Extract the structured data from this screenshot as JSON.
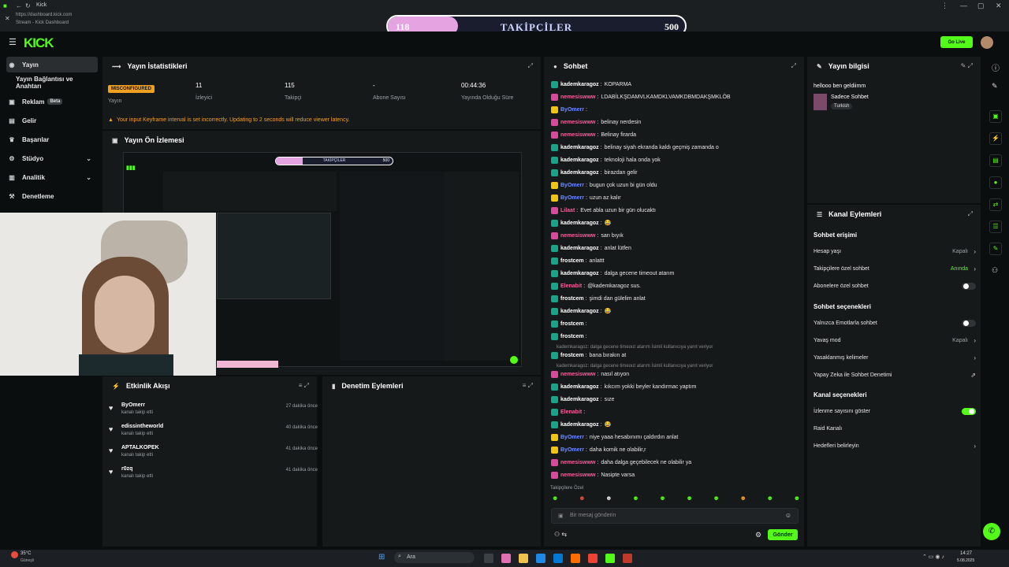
{
  "browser": {
    "tab_title": "Kick",
    "url": "https://dashboard.kick.com",
    "subtitle": "Stream - Kick Dashboard"
  },
  "goal": {
    "label": "TAKİPÇİLER",
    "current": "118",
    "target": "500",
    "progress": 0.236
  },
  "nav": {
    "logo": "KICK",
    "go_live": "Go Live"
  },
  "sidebar": {
    "items": [
      {
        "label": "Yayın",
        "icon": "broadcast-icon"
      },
      {
        "label": "Yayın Bağlantısı ve Anahtarı",
        "icon": "key-icon"
      },
      {
        "label": "Reklam",
        "badge": "Beta",
        "icon": "ad-icon"
      },
      {
        "label": "Gelir",
        "icon": "money-icon"
      },
      {
        "label": "Başarılar",
        "icon": "trophy-icon"
      },
      {
        "label": "Stüdyo",
        "icon": "studio-icon"
      },
      {
        "label": "Analitik",
        "icon": "chart-icon"
      },
      {
        "label": "Denetleme",
        "icon": "hammer-icon"
      }
    ]
  },
  "stats": {
    "title": "Yayın İstatistikleri",
    "status_badge": "MISCONFIGURED",
    "status_label": "Yayın",
    "viewers_value": "11",
    "viewers_label": "İzleyici",
    "followers_value": "115",
    "followers_label": "Takipçi",
    "subs_value": "-",
    "subs_label": "Abone Sayısı",
    "uptime_value": "00:44:36",
    "uptime_label": "Yayında Olduğu Süre",
    "warning": "Your input Keyframe interval is set incorrectly. Updating to 2 seconds will reduce viewer latency."
  },
  "preview": {
    "title": "Yayın Ön İzlemesi",
    "goal_label": "TAKİPÇİLER",
    "goal_target": "500"
  },
  "activity": {
    "title": "Etkinlik Akışı",
    "items": [
      {
        "name": "ByOmerr",
        "sub": "kanalı takip etti",
        "time": "27 dakika önce"
      },
      {
        "name": "edissintheworld",
        "sub": "kanalı takip etti",
        "time": "40 dakika önce"
      },
      {
        "name": "APTALKOPEK",
        "sub": "kanalı takip etti",
        "time": "41 dakika önce"
      },
      {
        "name": "r0zq",
        "sub": "kanalı takip etti",
        "time": "41 dakika önce"
      }
    ]
  },
  "moderation": {
    "title": "Denetim Eylemleri"
  },
  "chat": {
    "title": "Sohbet",
    "messages": [
      {
        "user": "kademkaragoz",
        "color": "#ffffff",
        "badge": "#17a589",
        "text": "KOPARMA"
      },
      {
        "user": "nemesiswww",
        "color": "#f0609a",
        "badge": "#d9489b",
        "text": "LDABİLKŞDAMVLKAMDKLVAMKDBMDAKŞMKLÖB"
      },
      {
        "user": "ByOmerr",
        "color": "#6f8cff",
        "badge": "#f1c40f",
        "text": ""
      },
      {
        "user": "nemesiswww",
        "color": "#f0609a",
        "badge": "#d9489b",
        "text": "belinay nerdesin"
      },
      {
        "user": "nemesiswww",
        "color": "#f0609a",
        "badge": "#d9489b",
        "text": "Belinay firarda"
      },
      {
        "user": "kademkaragoz",
        "color": "#ffffff",
        "badge": "#17a589",
        "text": "belinay siyah ekranda kaldı geçmiş zamanda o"
      },
      {
        "user": "kademkaragoz",
        "color": "#ffffff",
        "badge": "#17a589",
        "text": "teknoloji hala onda yok"
      },
      {
        "user": "kademkaragoz",
        "color": "#ffffff",
        "badge": "#17a589",
        "text": "birazdan gelir"
      },
      {
        "user": "ByOmerr",
        "color": "#6f8cff",
        "badge": "#f1c40f",
        "text": "bugun çok uzun bi gün oldu"
      },
      {
        "user": "ByOmerr",
        "color": "#6f8cff",
        "badge": "#f1c40f",
        "text": "uzun az kalır"
      },
      {
        "user": "Lilaat",
        "color": "#f0609a",
        "badge": "#d9489b",
        "text": "Evet abla uzun bir gün olucaktı"
      },
      {
        "user": "kademkaragoz",
        "color": "#ffffff",
        "badge": "#17a589",
        "text": "😂"
      },
      {
        "user": "nemesiswww",
        "color": "#f0609a",
        "badge": "#d9489b",
        "text": "sarı bıyık"
      },
      {
        "user": "kademkaragoz",
        "color": "#ffffff",
        "badge": "#17a589",
        "text": "anlat lütfen"
      },
      {
        "user": "frostcem",
        "color": "#ffffff",
        "badge": "#17a589",
        "text": "anlattt"
      },
      {
        "user": "kademkaragoz",
        "color": "#ffffff",
        "badge": "#17a589",
        "text": "dalga gecene timeout atarım"
      },
      {
        "user": "Elenabit",
        "color": "#f0609a",
        "badge": "#17a589",
        "text": "@kademkaragoz sus."
      },
      {
        "user": "frostcem",
        "color": "#ffffff",
        "badge": "#17a589",
        "text": "şimdi dan gülelim anlat"
      },
      {
        "user": "kademkaragoz",
        "color": "#ffffff",
        "badge": "#17a589",
        "text": "😂"
      },
      {
        "user": "frostcem",
        "color": "#ffffff",
        "badge": "#17a589",
        "text": ""
      },
      {
        "user": "frostcem",
        "color": "#ffffff",
        "badge": "#17a589",
        "text": ""
      },
      {
        "user": "frostcem",
        "color": "#ffffff",
        "badge": "#17a589",
        "text": "bana bırakın at"
      },
      {
        "user": "nemesiswww",
        "color": "#f0609a",
        "badge": "#d9489b",
        "text": "nasıl atıyon"
      },
      {
        "user": "kademkaragoz",
        "color": "#ffffff",
        "badge": "#17a589",
        "text": "kıkcım yokki beyler kandırmac yaptım"
      },
      {
        "user": "kademkaragoz",
        "color": "#ffffff",
        "badge": "#17a589",
        "text": "sıze"
      },
      {
        "user": "Elenabit",
        "color": "#f0609a",
        "badge": "#17a589",
        "text": ""
      },
      {
        "user": "kademkaragoz",
        "color": "#ffffff",
        "badge": "#17a589",
        "text": "😂"
      },
      {
        "user": "ByOmerr",
        "color": "#6f8cff",
        "badge": "#f1c40f",
        "text": "niye yaaa hesabınımı çaldırdın anlat"
      },
      {
        "user": "ByOmerr",
        "color": "#6f8cff",
        "badge": "#f1c40f",
        "text": "daha komik ne olabilir,r"
      },
      {
        "user": "nemesiswww",
        "color": "#f0609a",
        "badge": "#d9489b",
        "text": "daha dalga geçebilecek ne olabilir ya"
      },
      {
        "user": "nemesiswww",
        "color": "#f0609a",
        "badge": "#d9489b",
        "text": "Nasipte varsa"
      }
    ],
    "reply_context": "kademkaragoz: dalga gecene timeout atarım İsimli kullanıcıya yanıt veriyor",
    "followers_only": "Takipçilere Özel",
    "input_placeholder": "Bir mesaj gönderin",
    "send": "Gönder"
  },
  "stream_info": {
    "title": "Yayın bilgisi",
    "stream_title": "hellooo ben geldiimm",
    "category": "Sadece Sohbet",
    "tag": "Turkish"
  },
  "channel_actions": {
    "title": "Kanal Eylemleri",
    "chat_access_head": "Sohbet erişimi",
    "account_age": "Hesap yaşı",
    "account_age_val": "Kapalı",
    "followers_chat": "Takipçilere özel sohbet",
    "followers_chat_val": "Anında",
    "subs_chat": "Abonelere özel sohbet",
    "chat_options_head": "Sohbet seçenekleri",
    "emote_only": "Yalnızca Emotlarla sohbet",
    "slow_mode": "Yavaş mod",
    "slow_mode_val": "Kapalı",
    "banned_words": "Yasaklanmış kelimeler",
    "ai_moderation": "Yapay Zeka ile Sohbet Denetimi",
    "channel_options_head": "Kanal seçenekleri",
    "show_viewers": "İzlenme sayısını göster",
    "raid": "Raid Kanalı",
    "host": "Hedefleri belirleyin"
  },
  "taskbar": {
    "search": "Ara",
    "weather": "35°C",
    "weather_sub": "Güneşli",
    "time": "14:27",
    "date": "5.08.2025"
  }
}
